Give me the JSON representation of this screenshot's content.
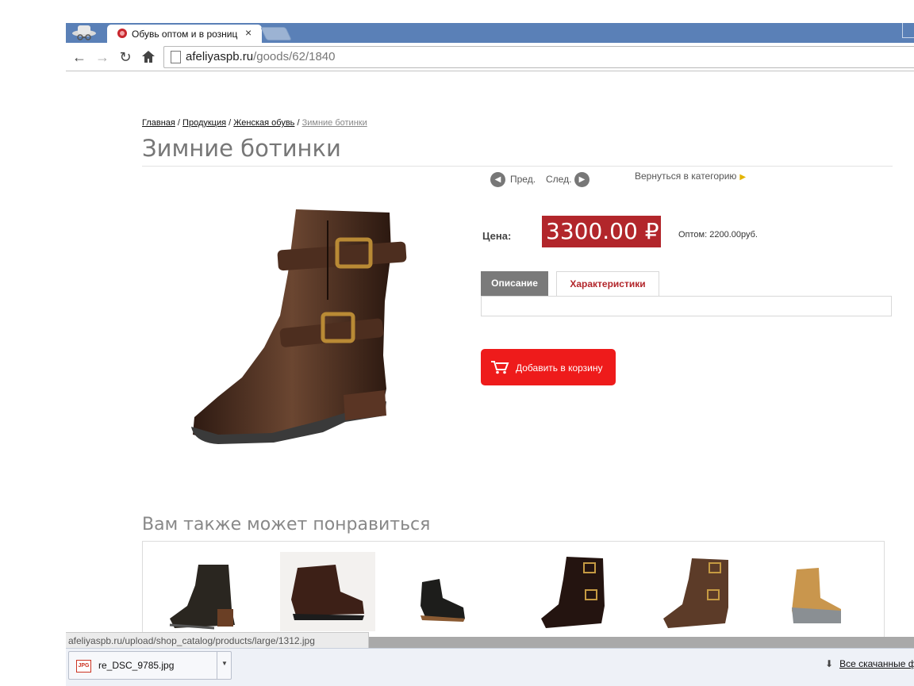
{
  "browser": {
    "tab_title": "Обувь оптом и в розниц",
    "tab_close": "×",
    "url_domain": "afeliyaspb.ru",
    "url_path": "/goods/62/1840"
  },
  "breadcrumb": {
    "items": [
      "Главная",
      "Продукция",
      "Женская обувь"
    ],
    "separator": " / ",
    "current": "Зимние ботинки"
  },
  "product": {
    "title": "Зимние ботинки",
    "nav": {
      "prev": "Пред.",
      "next": "След.",
      "back": "Вернуться в категорию"
    },
    "price_label": "Цена:",
    "price": "3300.00",
    "currency": "₽",
    "wholesale": "Оптом: 2200.00руб.",
    "tabs": [
      "Описание",
      "Характеристики"
    ],
    "add_to_cart": "Добавить в корзину"
  },
  "related": {
    "title": "Вам также может понравиться"
  },
  "status": {
    "url": "afeliyaspb.ru/upload/shop_catalog/products/large/1312.jpg"
  },
  "downloads": {
    "file": "re_DSC_9785.jpg",
    "file_type": "JPG",
    "show_all": "Все скачанные ф"
  },
  "colors": {
    "price_bg": "#b2262b",
    "cart_bg": "#ee1b1b",
    "tab_bar": "#5a80b7"
  }
}
